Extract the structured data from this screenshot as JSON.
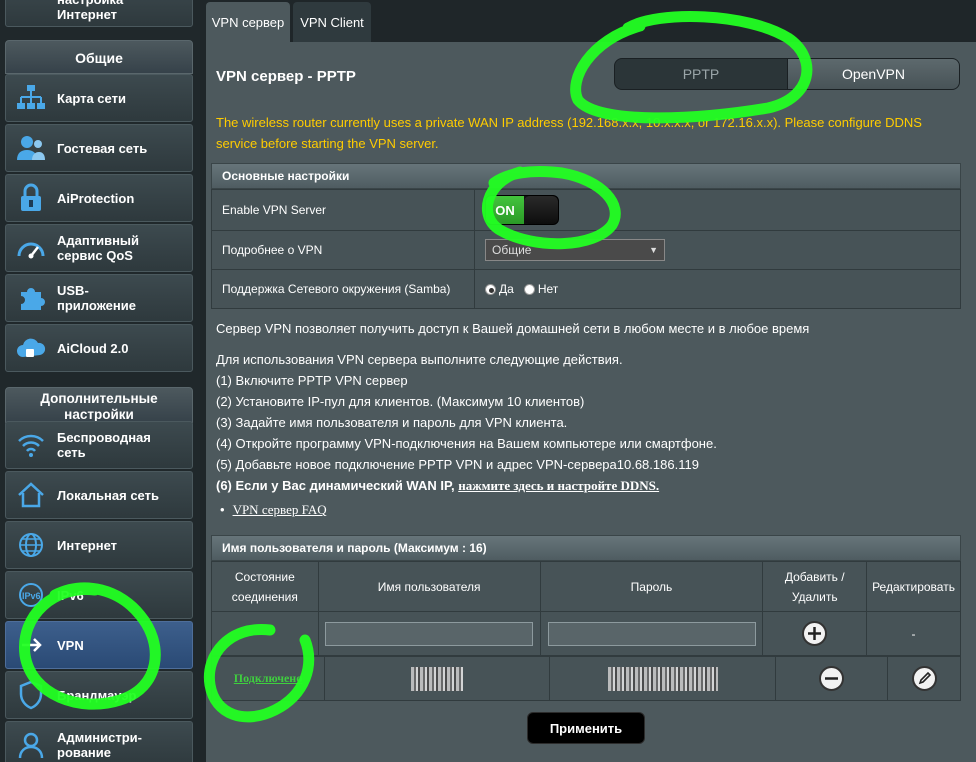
{
  "sidebar": {
    "top_partial_label": "настройка\nИнтернет",
    "general_header": "Общие",
    "general_items": [
      {
        "label": "Карта сети",
        "icon": "network-map-icon"
      },
      {
        "label": "Гостевая сеть",
        "icon": "guest-network-icon"
      },
      {
        "label": "AiProtection",
        "icon": "lock-icon"
      },
      {
        "label": "Адаптивный\nсервис QoS",
        "icon": "speedometer-icon"
      },
      {
        "label": "USB-\nприложение",
        "icon": "puzzle-icon"
      },
      {
        "label": "AiCloud 2.0",
        "icon": "cloud-icon"
      }
    ],
    "advanced_header": "Дополнительные\nнастройки",
    "advanced_items": [
      {
        "label": "Беспроводная\nсеть",
        "icon": "wifi-icon"
      },
      {
        "label": "Локальная сеть",
        "icon": "home-icon"
      },
      {
        "label": "Интернет",
        "icon": "globe-icon"
      },
      {
        "label": "IPv6",
        "icon": "ipv6-globe-icon"
      },
      {
        "label": "VPN",
        "icon": "vpn-icon"
      },
      {
        "label": "Брандмауэр",
        "icon": "shield-icon"
      },
      {
        "label": "Админист­ри-\nрование",
        "icon": "admin-user-icon"
      }
    ]
  },
  "tabs": [
    "VPN сервер",
    "VPN Client"
  ],
  "page_title": "VPN сервер - PPTP",
  "segment": {
    "pptp": "PPTP",
    "openvpn": "OpenVPN"
  },
  "warning": "The wireless router currently uses a private WAN IP address (192.168.x.x, 10.x.x.x, or 172.16.x.x). Please configure DDNS service before starting the VPN server.",
  "basic": {
    "header": "Основные настройки",
    "enable_label": "Enable VPN Server",
    "enable_state": "ON",
    "details_label": "Подробнее о VPN",
    "details_value": "Общие",
    "samba_label": "Поддержка Сетевого окружения (Samba)",
    "samba_yes": "Да",
    "samba_no": "Нет"
  },
  "info": {
    "line1": "Сервер VPN позволяет получить доступ к Вашей домашней сети в любом месте и в любое время",
    "line2": "Для использования VPN сервера выполните следующие действия.",
    "step1": "(1) Включите PPTP VPN сервер",
    "step2": "(2) Установите IP-пул для клиентов. (Максимум 10 клиентов)",
    "step3": "(3) Задайте имя пользователя и пароль для VPN клиента.",
    "step4": "(4) Откройте программу VPN-подключения на Вашем компьютере или смартфоне.",
    "step5": "(5) Добавьте новое подключение PPTP VPN и адрес VPN-сервера10.68.186.119",
    "step6_bold": "(6) Если у Вас динамический WAN IP,",
    "step6_link": "нажмите здесь и настройте DDNS.",
    "faq": "VPN сервер FAQ"
  },
  "users": {
    "header": "Имя пользователя и пароль (Максимум : 16)",
    "col_status": "Состояние\nсоединения",
    "col_user": "Имя пользователя",
    "col_pass": "Пароль",
    "col_addrm": "Добавить /\nУдалить",
    "col_edit": "Редактировать",
    "edit_placeholder": "-",
    "row_status": "Подключено"
  },
  "apply_label": "Применить",
  "colors": {
    "warning": "#ffcc00",
    "on_green": "#2fa92b",
    "highlight": "#22ff22"
  }
}
